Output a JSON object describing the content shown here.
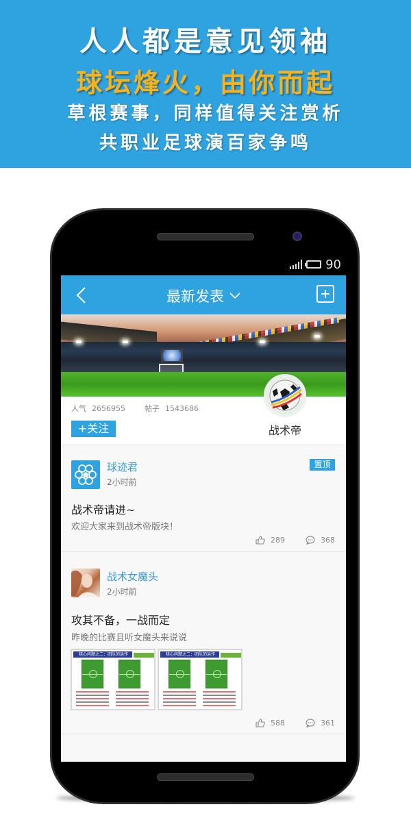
{
  "banner": {
    "line1": "人人都是意见领袖",
    "line2": "球坛烽火，由你而起",
    "line3": "草根赛事，同样值得关注赏析",
    "line4": "共职业足球演百家争鸣",
    "colors": {
      "background": "#2fa2e0",
      "highlight": "#f7b21c"
    }
  },
  "status_bar": {
    "battery_level": "90",
    "signal_icon": "signal-icon",
    "battery_icon": "battery-icon"
  },
  "navbar": {
    "back_icon": "chevron-left-icon",
    "title": "最新发表",
    "title_dropdown_icon": "chevron-down-icon",
    "add_icon": "plus-square-icon",
    "color": "#2fa2e0"
  },
  "board": {
    "name": "战术帝",
    "popularity_label": "人气",
    "popularity_value": "2656955",
    "posts_label": "帖子",
    "posts_value": "1543686",
    "follow_label": "+关注"
  },
  "posts": [
    {
      "author": "球迹君",
      "time": "2小时前",
      "pinned_label": "置顶",
      "title": "战术帝请进~",
      "description": "欢迎大家来到战术帝版块！",
      "likes": "289",
      "comments": "368"
    },
    {
      "author": "战术女魔头",
      "time": "2小时前",
      "title": "攻其不备，一战而定",
      "description": "昨晚的比赛且听女魔头来说说",
      "images": [
        {
          "caption": "核心问题之二：团队的运作"
        },
        {
          "caption": "核心问题之二：团队的运作"
        }
      ],
      "likes": "588",
      "comments": "361"
    }
  ]
}
